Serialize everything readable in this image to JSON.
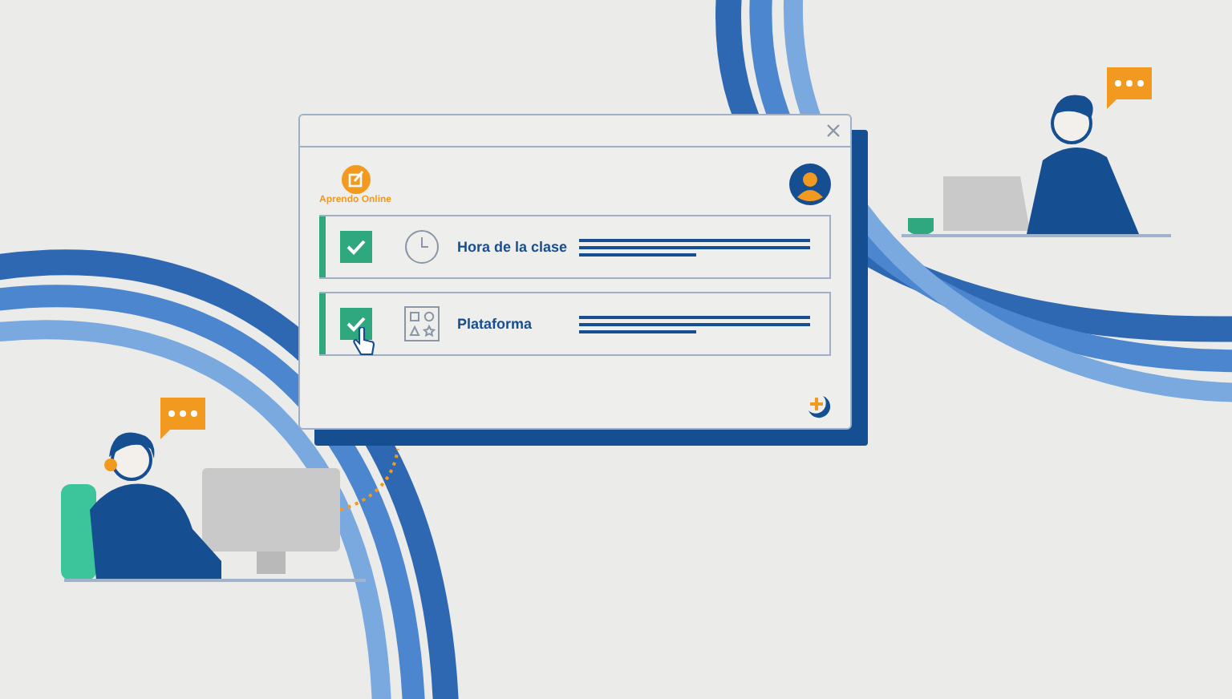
{
  "window": {
    "logo_text": "Aprendo Online",
    "items": [
      {
        "label": "Hora de la clase",
        "checked": true,
        "kind": "clock"
      },
      {
        "label": "Plataforma",
        "checked": true,
        "kind": "shapes"
      }
    ]
  }
}
